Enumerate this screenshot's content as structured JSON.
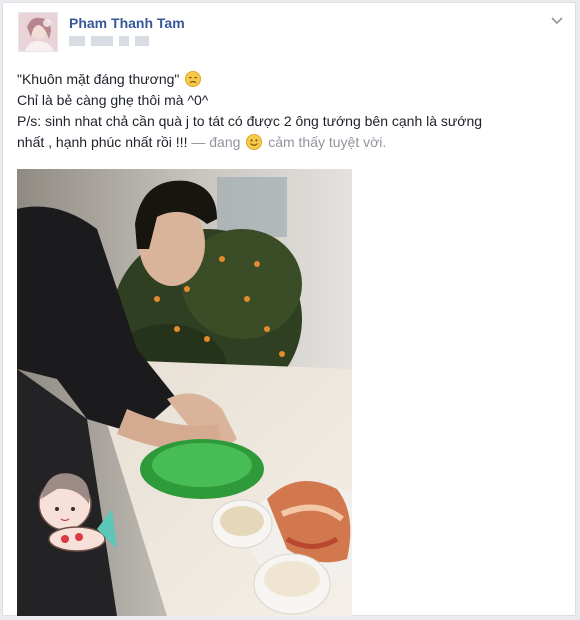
{
  "post": {
    "author": "Pham Thanh Tam",
    "menu_icon": "chevron-down-icon",
    "lines": {
      "line1": "\"Khuôn mặt đáng thương\"",
      "line2": "Chỉ là bẻ càng ghẹ thôi mà ^0^",
      "line3": "P/s: sinh nhat chả cần quà j to tát có được 2 ông tướng bên cạnh là sướng",
      "line4": "nhất , hạnh phúc nhất rồi !!!",
      "status_prefix": "— đang",
      "status_text": "cảm thấy tuyệt vời."
    },
    "emoji_1": "sad-face-emoji-icon",
    "emoji_2": "smile-emoji-icon",
    "photo_description_icon": "post-photo"
  },
  "colors": {
    "author": "#365899",
    "text": "#1d2129",
    "muted": "#90949c",
    "page_bg": "#e9ebee"
  }
}
